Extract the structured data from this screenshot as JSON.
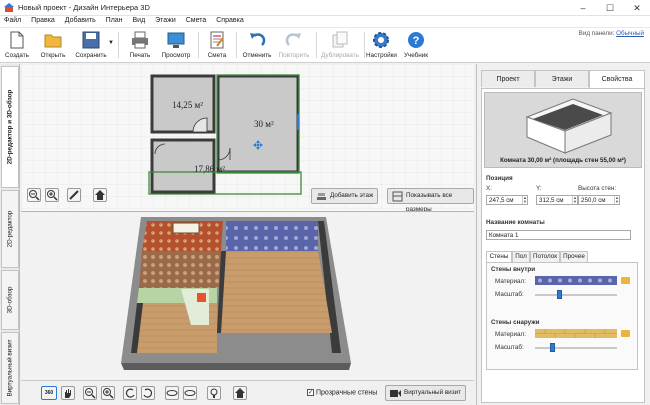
{
  "window": {
    "title": "Новый проект - Дизайн Интерьера 3D",
    "minimize": "–",
    "maximize": "☐",
    "close": "✕"
  },
  "menu": [
    "Файл",
    "Правка",
    "Добавить",
    "План",
    "Вид",
    "Этажи",
    "Смета",
    "Справка"
  ],
  "toolbar": {
    "create": "Создать",
    "open": "Открыть",
    "save": "Сохранить",
    "print": "Печать",
    "preview": "Просмотр",
    "estimate": "Смета",
    "undo": "Отменить",
    "redo": "Повторить",
    "duplicate": "Дублировать",
    "settings": "Настройки",
    "tutorial": "Учебник"
  },
  "view_panel": {
    "label": "Вид панели:",
    "value": "Обычный"
  },
  "left_tabs": [
    "2D-редактор и 3D-обзор",
    "2D-редактор",
    "3D-обзор",
    "Виртуальный визит"
  ],
  "plan": {
    "room_big": "30 м²",
    "room_small_top": "14,25 м²",
    "room_small_bottom": "17,86 м²",
    "add_floor": "Добавить этаж",
    "show_sizes": "Показывать все размеры"
  },
  "bottom_bar": {
    "transparent_walls": "Прозрачные стены",
    "virtual_visit": "Виртуальный визит",
    "btn_360": "360"
  },
  "right_panel": {
    "tabs": [
      "Проект",
      "Этажи",
      "Свойства"
    ],
    "preview_caption": "Комната 30,00 м² (площадь стен 55,00 м²)",
    "position_title": "Позиция",
    "x_label": "X:",
    "y_label": "Y:",
    "wall_height_label": "Высота стен:",
    "x_value": "247,5 см",
    "y_value": "312,5 см",
    "wall_height_value": "250,0 см",
    "room_name_title": "Название комнаты",
    "room_name_value": "Комната 1",
    "subtabs": [
      "Стены",
      "Пол",
      "Потолок",
      "Прочее"
    ],
    "walls_inside": "Стены внутри",
    "walls_outside": "Стены снаружи",
    "material_label": "Материал:",
    "scale_label": "Масштаб:",
    "inside_scale": 0.3,
    "outside_scale": 0.22
  },
  "colors": {
    "accent": "#2b7bd4",
    "wall_green": "#3a8a3a",
    "floor_wood": "#c79a6a",
    "wallpaper_blue": "#5a64a8"
  }
}
